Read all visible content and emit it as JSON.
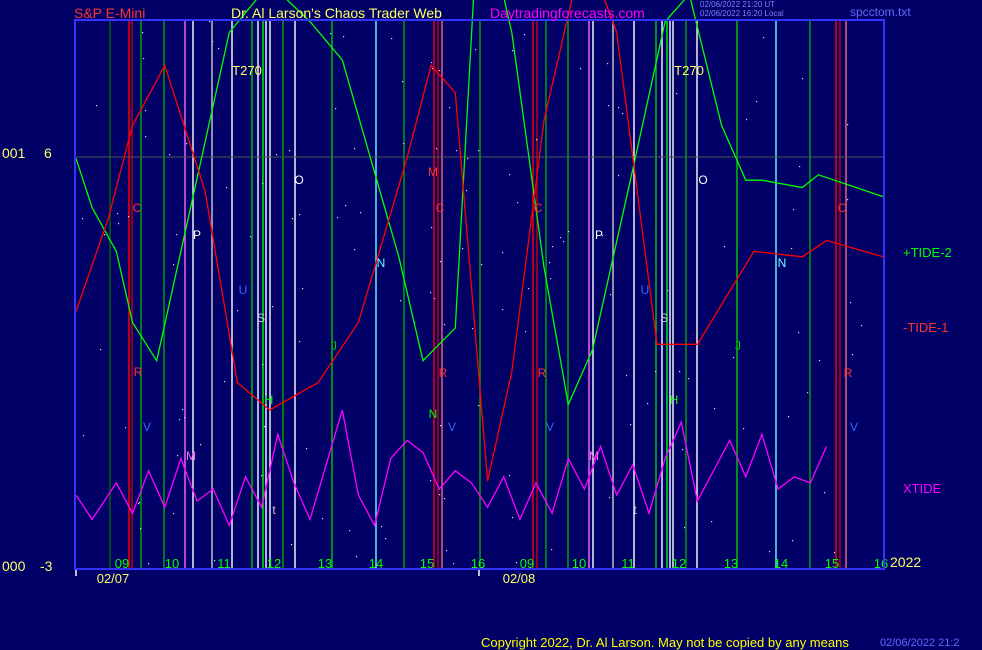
{
  "header": {
    "instrument": "S&P E-Mini",
    "site_title": "Dr. Al Larson's Chaos Trader Web",
    "site_url": "Daytradingforecasts.com",
    "timestamp_line1": "02/06/2022 21:20 UT",
    "timestamp_line2": "02/06/2022 16:20 Local",
    "file_name": "spcctom.txt"
  },
  "y_axis": {
    "top_left": "001",
    "top_value": "6",
    "bottom_left": "000",
    "bottom_value": "-3"
  },
  "legend": {
    "tide2": "+TIDE-2",
    "tide1": "-TIDE-1",
    "xtide": "XTIDE"
  },
  "footer": {
    "copyright": "Copyright 2022, Dr. Al Larson. May not be copied by any means",
    "overflow_text": "02/06/2022 21:2"
  },
  "colors": {
    "background": "#000066",
    "frame": "#3333ff",
    "tide2": "#00ff00",
    "tide1": "#ff0000",
    "xtide": "#ff00ff",
    "hour_labels": "#00ff00",
    "date_labels": "#ffff66"
  },
  "chart_data": {
    "type": "line",
    "x_axis": {
      "hour_ticks": [
        "09",
        "10",
        "11",
        "12",
        "13",
        "14",
        "15",
        "16",
        "09",
        "10",
        "11",
        "12",
        "13",
        "14",
        "15",
        "16"
      ],
      "dates": [
        "02/07",
        "02/08"
      ],
      "year": "2022"
    },
    "y_range": [
      -3,
      6
    ],
    "annotations": [
      "T270",
      "T270"
    ],
    "series": [
      {
        "name": "+TIDE-2",
        "color": "#00ff00",
        "points": [
          [
            0.0,
            3.74
          ],
          [
            0.02,
            2.93
          ],
          [
            0.05,
            2.21
          ],
          [
            0.07,
            1.04
          ],
          [
            0.1,
            0.41
          ],
          [
            0.13,
            2.21
          ],
          [
            0.19,
            5.81
          ],
          [
            0.24,
            6.62
          ],
          [
            0.29,
            5.99
          ],
          [
            0.33,
            5.36
          ],
          [
            0.4,
            2.12
          ],
          [
            0.43,
            0.41
          ],
          [
            0.47,
            0.95
          ],
          [
            0.5,
            8.15
          ],
          [
            0.54,
            5.81
          ],
          [
            0.58,
            1.94
          ],
          [
            0.61,
            -0.31
          ],
          [
            0.64,
            0.59
          ],
          [
            0.69,
            3.56
          ],
          [
            0.73,
            5.99
          ],
          [
            0.76,
            6.44
          ],
          [
            0.8,
            4.28
          ],
          [
            0.83,
            3.38
          ],
          [
            0.85,
            3.38
          ],
          [
            0.9,
            3.26
          ],
          [
            0.92,
            3.47
          ],
          [
            1.0,
            3.11
          ]
        ]
      },
      {
        "name": "-TIDE-1",
        "color": "#ff0000",
        "points": [
          [
            0.0,
            1.22
          ],
          [
            0.04,
            2.75
          ],
          [
            0.07,
            4.28
          ],
          [
            0.11,
            5.27
          ],
          [
            0.16,
            3.2
          ],
          [
            0.2,
            0.05
          ],
          [
            0.24,
            -0.4
          ],
          [
            0.3,
            0.05
          ],
          [
            0.35,
            1.04
          ],
          [
            0.41,
            3.74
          ],
          [
            0.44,
            5.27
          ],
          [
            0.47,
            4.82
          ],
          [
            0.51,
            -1.57
          ],
          [
            0.54,
            0.23
          ],
          [
            0.58,
            4.37
          ],
          [
            0.63,
            7.25
          ],
          [
            0.67,
            5.81
          ],
          [
            0.72,
            0.68
          ],
          [
            0.77,
            0.68
          ],
          [
            0.84,
            2.21
          ],
          [
            0.9,
            2.12
          ],
          [
            0.93,
            2.39
          ],
          [
            1.0,
            2.12
          ]
        ]
      },
      {
        "name": "XTIDE",
        "color": "#ff00ff",
        "points": [
          [
            0.0,
            -1.8
          ],
          [
            0.02,
            -2.2
          ],
          [
            0.05,
            -1.6
          ],
          [
            0.07,
            -2.1
          ],
          [
            0.09,
            -1.4
          ],
          [
            0.11,
            -2.0
          ],
          [
            0.13,
            -1.2
          ],
          [
            0.15,
            -1.9
          ],
          [
            0.17,
            -1.7
          ],
          [
            0.19,
            -2.3
          ],
          [
            0.21,
            -1.5
          ],
          [
            0.23,
            -2.0
          ],
          [
            0.25,
            -0.8
          ],
          [
            0.27,
            -1.6
          ],
          [
            0.29,
            -2.2
          ],
          [
            0.31,
            -1.3
          ],
          [
            0.33,
            -0.4
          ],
          [
            0.35,
            -1.8
          ],
          [
            0.37,
            -2.3
          ],
          [
            0.39,
            -1.2
          ],
          [
            0.41,
            -0.9
          ],
          [
            0.43,
            -1.1
          ],
          [
            0.45,
            -1.7
          ],
          [
            0.47,
            -1.4
          ],
          [
            0.49,
            -1.6
          ],
          [
            0.51,
            -2.0
          ],
          [
            0.53,
            -1.5
          ],
          [
            0.55,
            -2.2
          ],
          [
            0.57,
            -1.6
          ],
          [
            0.59,
            -2.1
          ],
          [
            0.61,
            -1.2
          ],
          [
            0.63,
            -1.7
          ],
          [
            0.65,
            -1.0
          ],
          [
            0.67,
            -1.8
          ],
          [
            0.69,
            -1.3
          ],
          [
            0.71,
            -2.1
          ],
          [
            0.73,
            -1.2
          ],
          [
            0.75,
            -0.6
          ],
          [
            0.77,
            -1.9
          ],
          [
            0.79,
            -1.4
          ],
          [
            0.81,
            -0.9
          ],
          [
            0.83,
            -1.5
          ],
          [
            0.85,
            -0.8
          ],
          [
            0.87,
            -1.7
          ],
          [
            0.89,
            -1.5
          ],
          [
            0.91,
            -1.6
          ],
          [
            0.93,
            -1.0
          ]
        ]
      }
    ]
  }
}
